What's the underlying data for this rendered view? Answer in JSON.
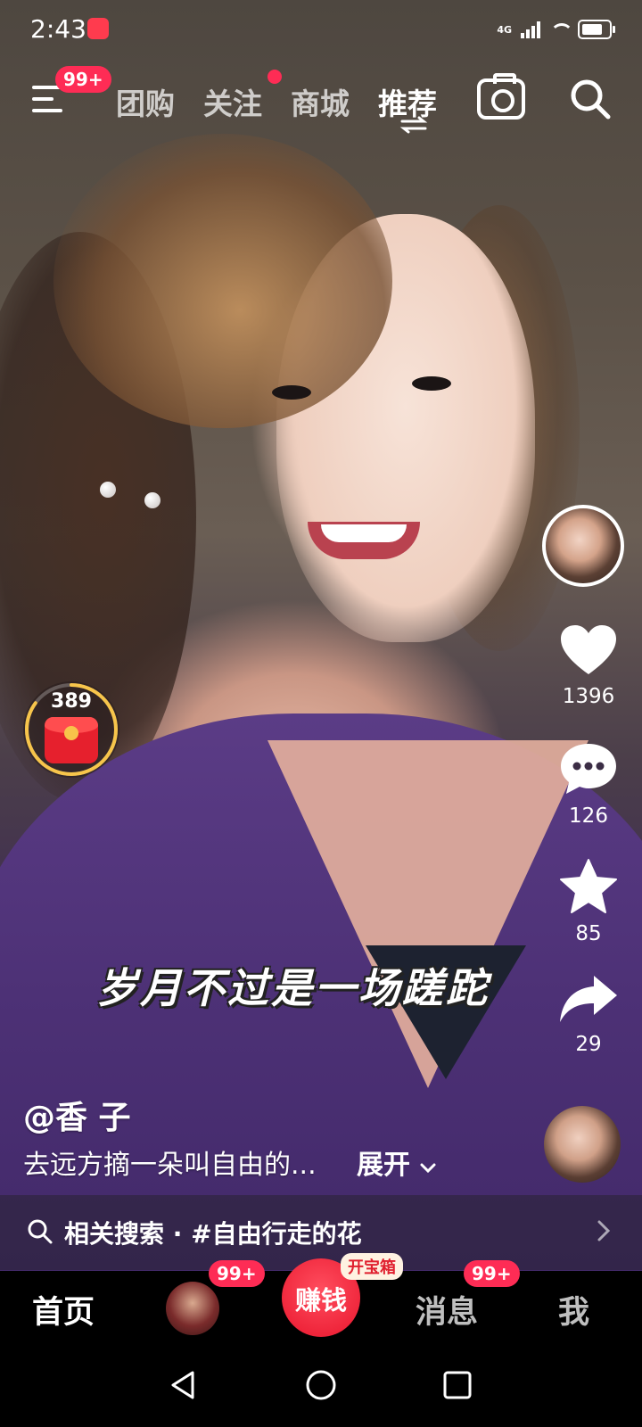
{
  "status_bar": {
    "time": "2:43",
    "network": "4G"
  },
  "top_nav": {
    "menu_badge": "99+",
    "tabs": [
      {
        "label": "团购",
        "active": false
      },
      {
        "label": "关注",
        "active": false,
        "has_dot": true
      },
      {
        "label": "商城",
        "active": false
      },
      {
        "label": "推荐",
        "active": true
      }
    ]
  },
  "right_rail": {
    "like_count": "1396",
    "comment_count": "126",
    "favorite_count": "85",
    "share_count": "29"
  },
  "red_packet": {
    "count": "389",
    "progress": 0.85
  },
  "video": {
    "caption": "岁月不过是一场蹉跎"
  },
  "post": {
    "author": "@香 子",
    "description": "去远方摘一朵叫自由的...",
    "expand_label": "展开"
  },
  "related_search": {
    "label": "相关搜索 · #自由行走的花"
  },
  "bottom_nav": {
    "home": "首页",
    "friends_badge": "99+",
    "earn": "赚钱",
    "earn_tag": "开宝箱",
    "messages": "消息",
    "messages_badge": "99+",
    "me": "我"
  },
  "colors": {
    "accent": "#fe2c55",
    "earn": "#e9162d"
  }
}
